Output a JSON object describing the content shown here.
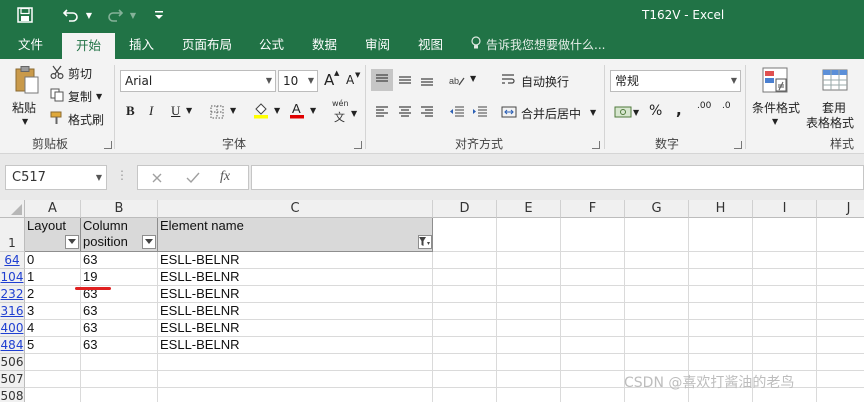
{
  "window": {
    "title": "T162V  -  Excel"
  },
  "tabs": [
    {
      "label": "文件"
    },
    {
      "label": "开始"
    },
    {
      "label": "插入"
    },
    {
      "label": "页面布局"
    },
    {
      "label": "公式"
    },
    {
      "label": "数据"
    },
    {
      "label": "审阅"
    },
    {
      "label": "视图"
    }
  ],
  "tell_me": "告诉我您想要做什么...",
  "ribbon": {
    "clipboard": {
      "paste": "粘贴",
      "cut": "剪切",
      "copy": "复制",
      "format_painter": "格式刷",
      "group": "剪贴板"
    },
    "font": {
      "name": "Arial",
      "size": "10",
      "group": "字体",
      "bold": "B",
      "italic": "I",
      "underline": "U",
      "grow": "A",
      "shrink": "A",
      "phonetic_top": "wén",
      "phonetic_bottom": "文"
    },
    "alignment": {
      "wrap": "自动换行",
      "merge": "合并后居中",
      "group": "对齐方式"
    },
    "number": {
      "format": "常规",
      "group": "数字",
      "percent": "%",
      "comma": ",",
      "inc": ".00",
      "dec": ".0"
    },
    "styles": {
      "conditional": "条件格式",
      "table_line1": "套用",
      "table_line2": "表格格式",
      "group": "样式"
    }
  },
  "formula_bar": {
    "name_box": "C517",
    "fx": "fx",
    "value": ""
  },
  "columns": [
    "A",
    "B",
    "C",
    "D",
    "E",
    "F",
    "G",
    "H",
    "I",
    "J"
  ],
  "header_row": {
    "row_number": "1",
    "a": "Layout",
    "b1": "Column",
    "b2": "position",
    "c": "Element name"
  },
  "rows": [
    {
      "num": "64",
      "a": "0",
      "b": "63",
      "c": "ESLL-BELNR"
    },
    {
      "num": "104",
      "a": "1",
      "b": "19",
      "c": "ESLL-BELNR"
    },
    {
      "num": "232",
      "a": "2",
      "b": "63",
      "c": "ESLL-BELNR"
    },
    {
      "num": "316",
      "a": "3",
      "b": "63",
      "c": "ESLL-BELNR"
    },
    {
      "num": "400",
      "a": "4",
      "b": "63",
      "c": "ESLL-BELNR"
    },
    {
      "num": "484",
      "a": "5",
      "b": "63",
      "c": "ESLL-BELNR"
    }
  ],
  "empty_rows": [
    "506",
    "507",
    "508"
  ],
  "watermark": "CSDN @喜欢打酱油的老鸟",
  "colors": {
    "accent": "#217346",
    "annotation": "#e02020",
    "filtered_row": "#1f3fd1"
  }
}
